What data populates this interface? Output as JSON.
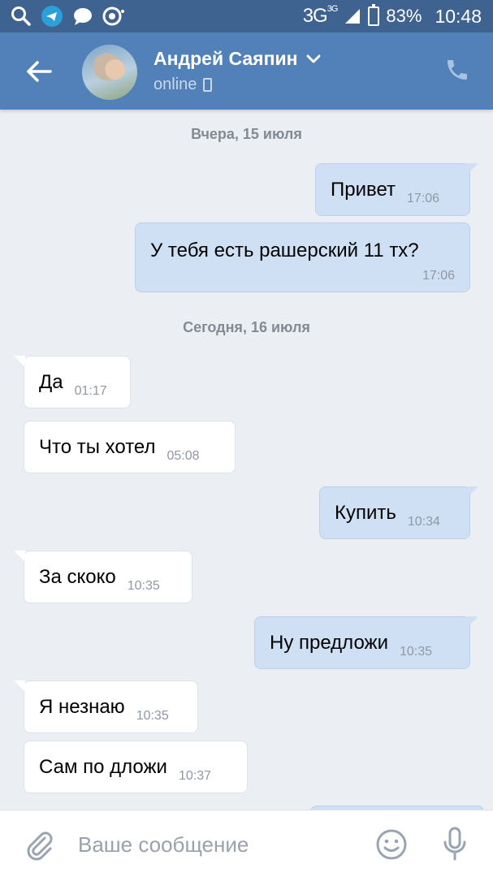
{
  "status_bar": {
    "network": "3G",
    "network_super": "3G",
    "battery": "83%",
    "time": "10:48",
    "left_icons": [
      "search-icon",
      "telegram-icon",
      "chat-bubble-icon",
      "record-icon"
    ]
  },
  "header": {
    "contact_name": "Андрей Саяпин",
    "status": "online"
  },
  "chat": {
    "date_1": "Вчера, 15 июля",
    "date_2": "Сегодня, 16 июля",
    "messages": [
      {
        "dir": "out",
        "text": "Привет",
        "time": "17:06"
      },
      {
        "dir": "out",
        "text": "У тебя есть рашерский 11 тх?",
        "time": "17:06"
      },
      {
        "dir": "in",
        "text": "Да",
        "time": "01:17"
      },
      {
        "dir": "in",
        "text": "Что ты хотел",
        "time": "05:08"
      },
      {
        "dir": "out",
        "text": "Купить",
        "time": "10:34"
      },
      {
        "dir": "in",
        "text": "За скоко",
        "time": "10:35"
      },
      {
        "dir": "out",
        "text": "Ну предложи",
        "time": "10:35"
      },
      {
        "dir": "in",
        "text": "Я незнаю",
        "time": "10:35"
      },
      {
        "dir": "in",
        "text": "Сам по дложи",
        "time": "10:37"
      }
    ]
  },
  "input": {
    "placeholder": "Ваше сообщение",
    "value": ""
  },
  "colors": {
    "status_bar": "#3f6390",
    "header": "#5181b8",
    "background": "#ebeef2",
    "outgoing_bubble": "#cfe0f5",
    "incoming_bubble": "#ffffff"
  }
}
